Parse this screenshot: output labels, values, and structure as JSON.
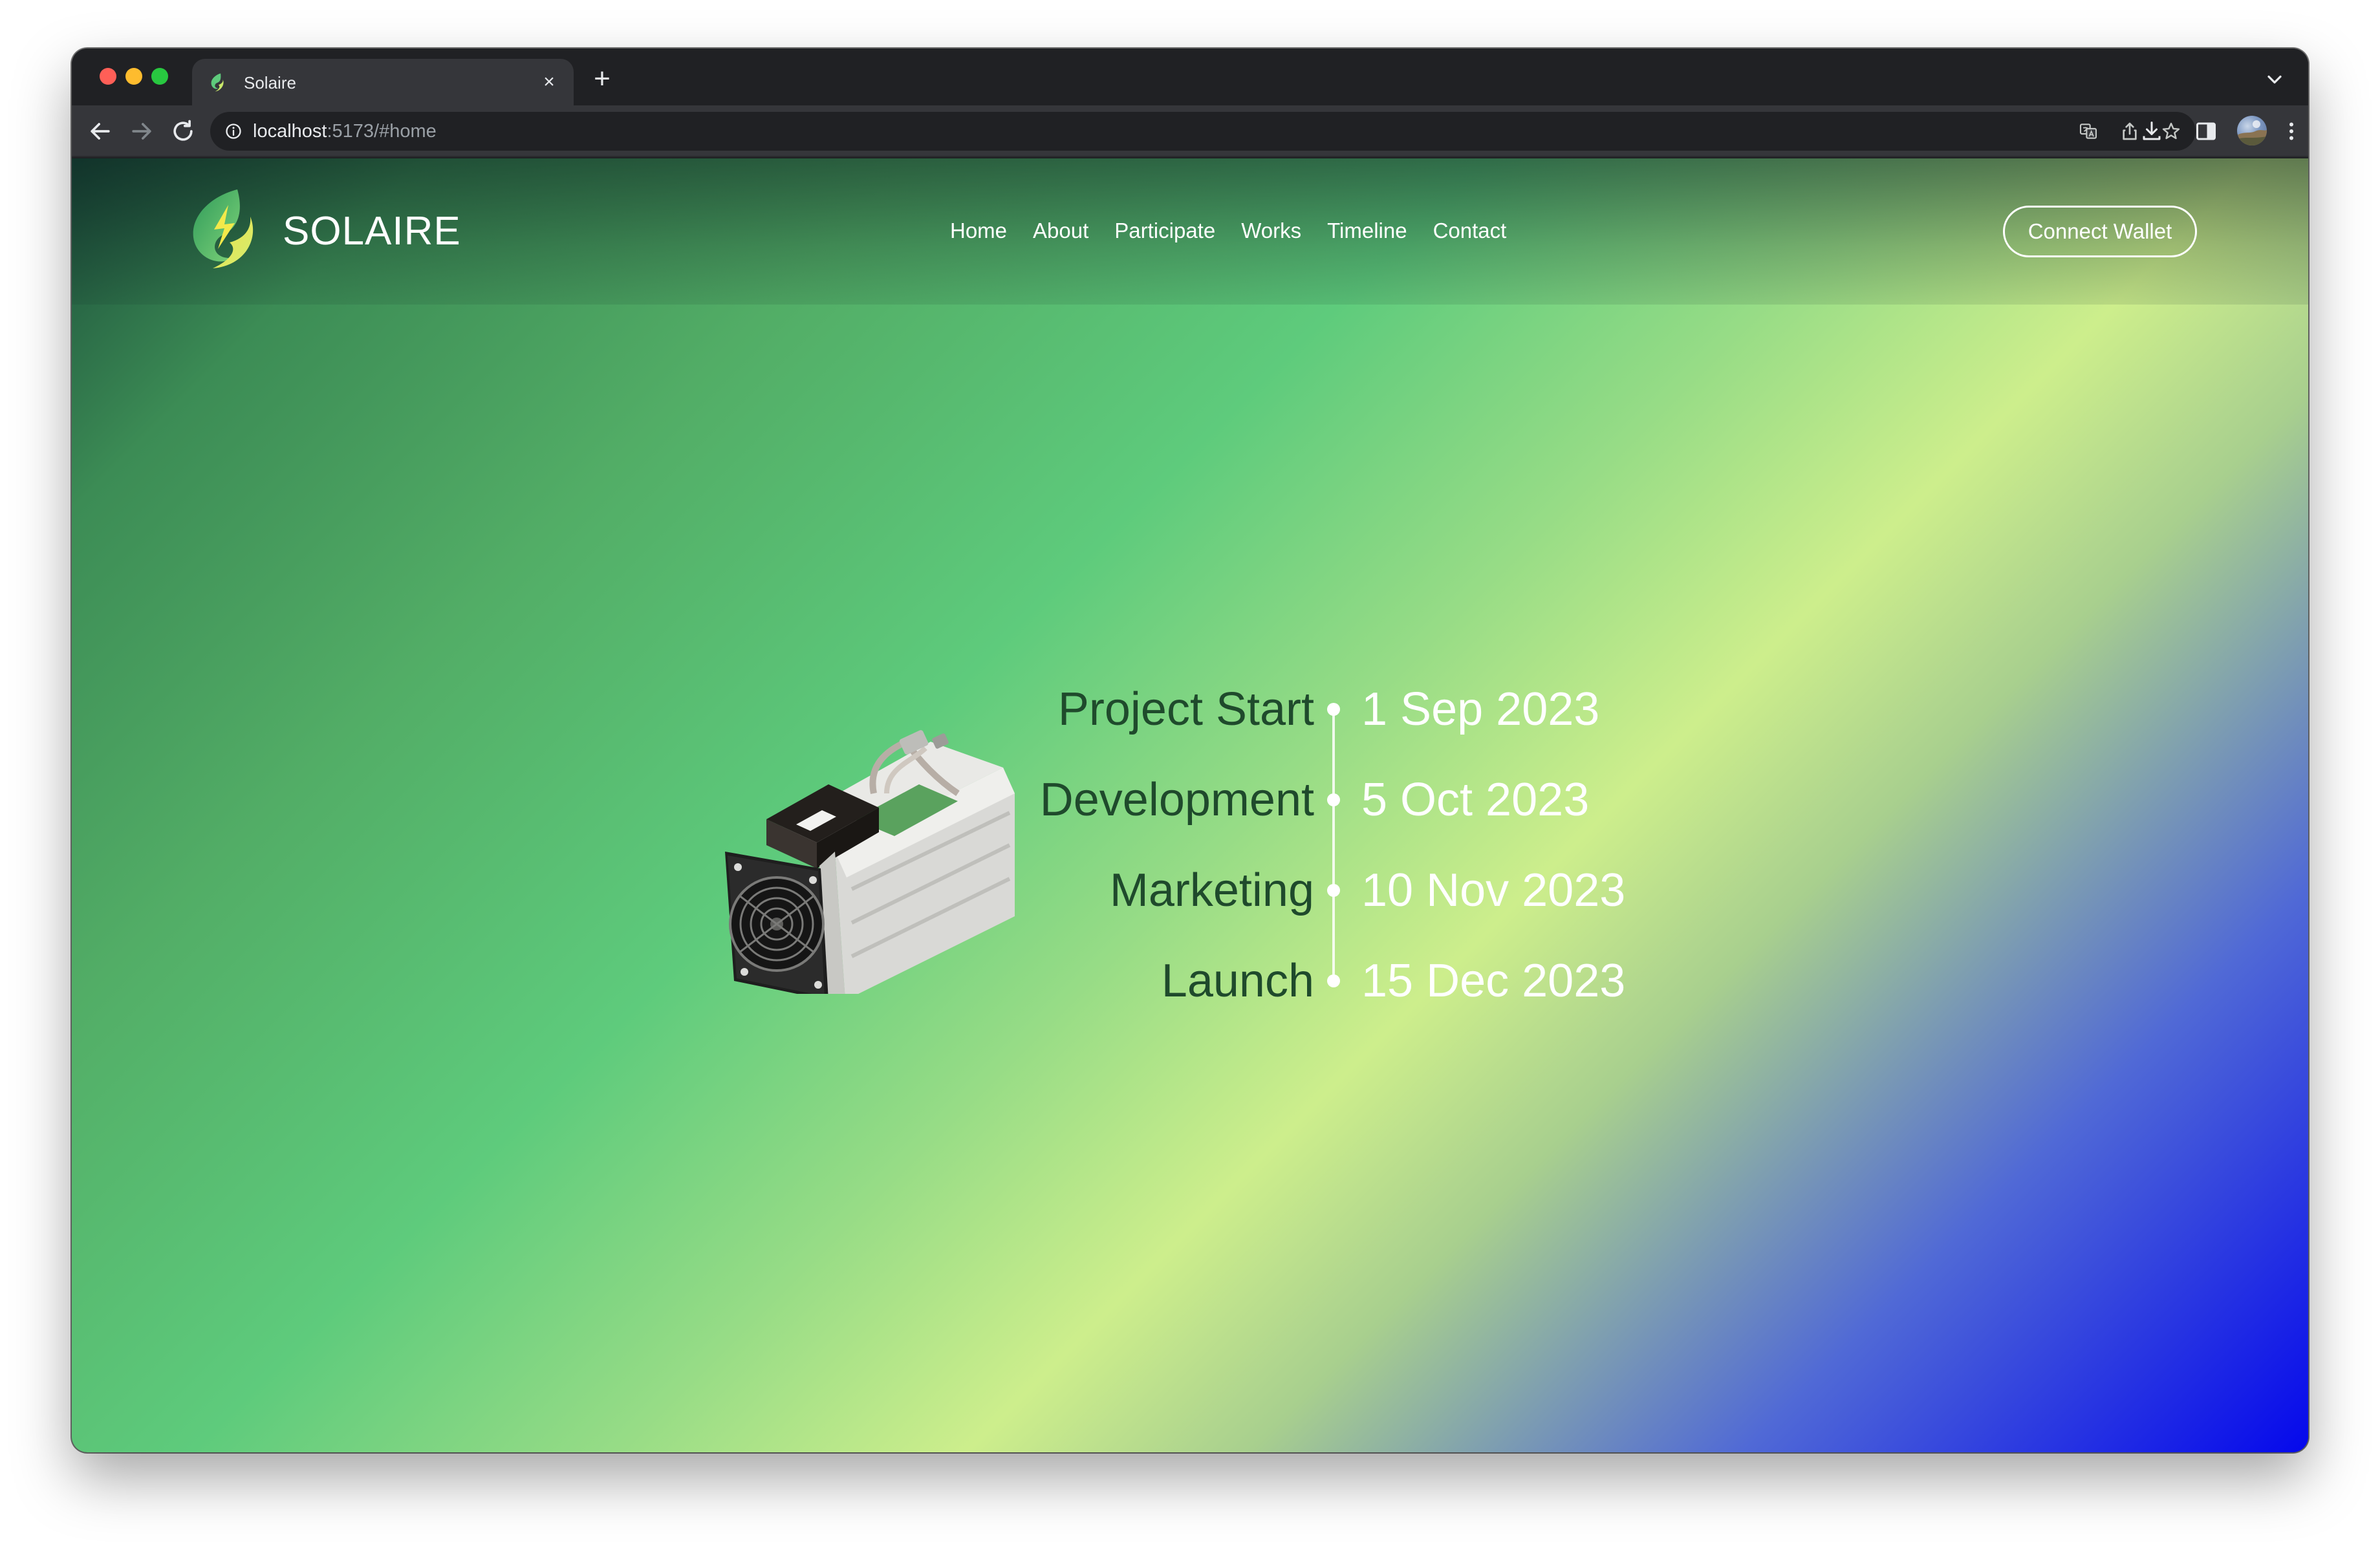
{
  "browser": {
    "tab_title": "Solaire",
    "tab_close": "×",
    "new_tab": "+",
    "url_host": "localhost",
    "url_rest": ":5173/#home",
    "icons": {
      "back": "arrow-left",
      "forward": "arrow-right",
      "reload": "reload",
      "site_info": "info-circle",
      "translate": "translate",
      "share": "share",
      "bookmark": "star",
      "download": "download",
      "side_panel": "side-panel",
      "menu": "kebab-menu",
      "tab_search": "chevron-down"
    }
  },
  "site": {
    "brand": "SOLAIRE",
    "nav": [
      "Home",
      "About",
      "Participate",
      "Works",
      "Timeline",
      "Contact"
    ],
    "cta": "Connect Wallet"
  },
  "timeline": [
    {
      "label": "Project Start",
      "date": "1 Sep 2023"
    },
    {
      "label": "Development",
      "date": "5 Oct 2023"
    },
    {
      "label": "Marketing",
      "date": "10 Nov 2023"
    },
    {
      "label": "Launch",
      "date": "15 Dec 2023"
    }
  ],
  "colors": {
    "brand_green": "#5ecb7c",
    "brand_yellow": "#cdee8c",
    "brand_blue": "#0508ec",
    "label_dark_green": "#1f4a2c"
  }
}
